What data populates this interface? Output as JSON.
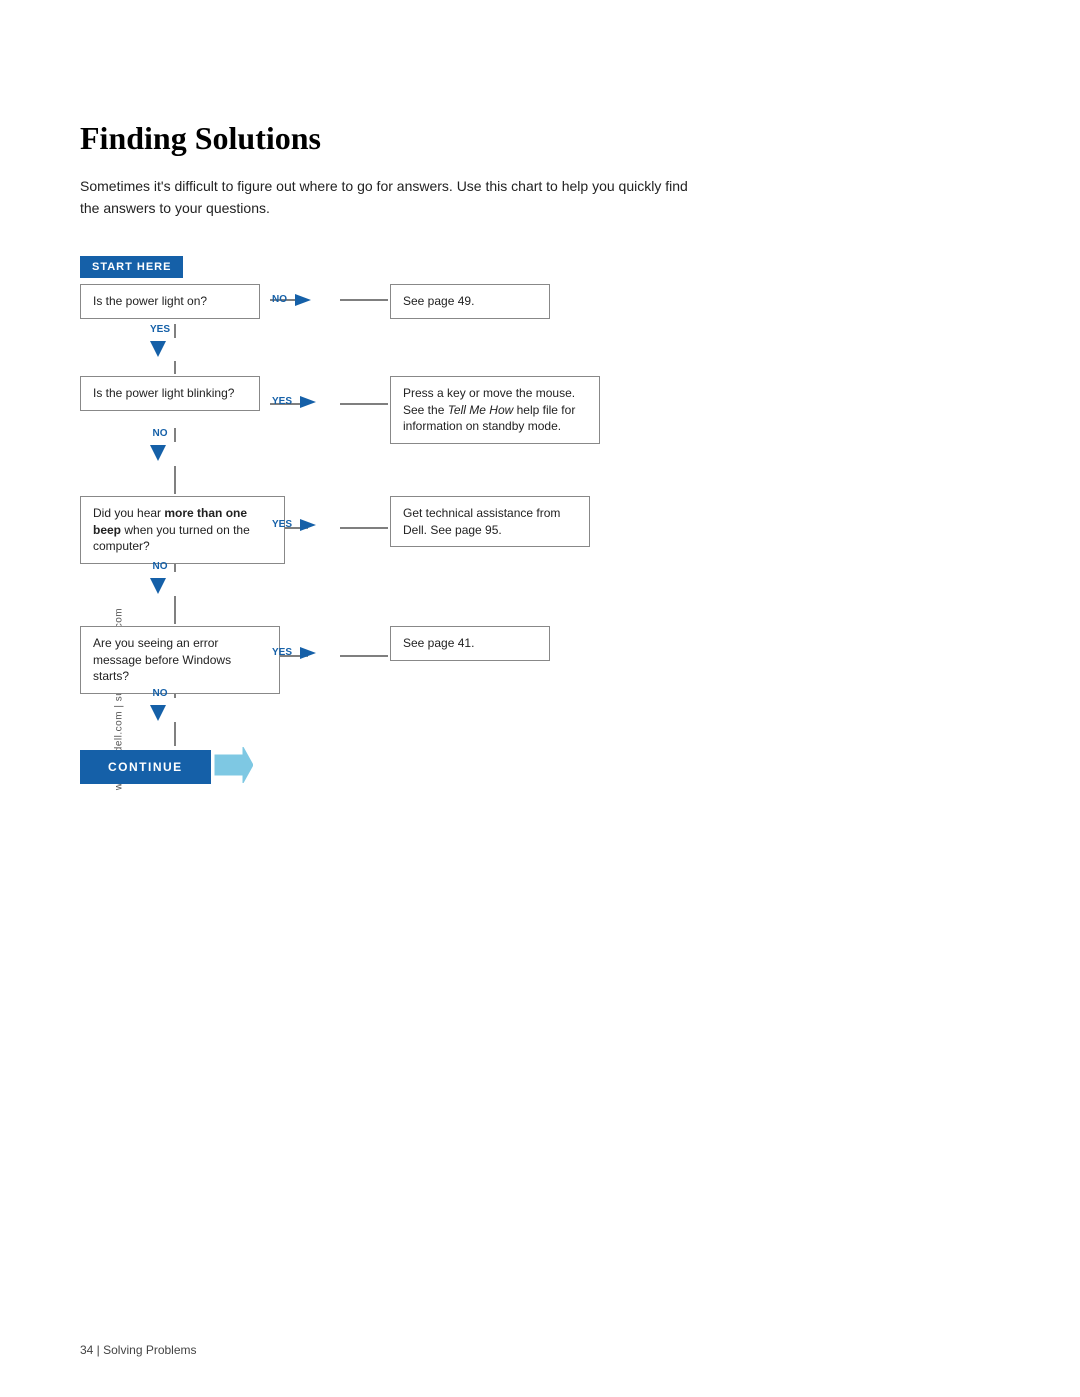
{
  "page": {
    "title": "Finding Solutions",
    "intro": "Sometimes it's difficult to figure out where to go for answers. Use this chart to help you quickly find the answers to your questions.",
    "sidebar_text": "www.jp.dell.com | support.jp.dell.com",
    "footer_text": "34  |  Solving Problems"
  },
  "flowchart": {
    "start_here_label": "START HERE",
    "steps": [
      {
        "id": "q1",
        "question": "Is the power light on?",
        "yes_answer": null,
        "no_answer": "See page 49.",
        "yes_direction": "down",
        "no_direction": "right"
      },
      {
        "id": "q2",
        "question": "Is the power light blinking?",
        "yes_answer": "Press a key or move the mouse. See the Tell Me How help file for information on standby mode.",
        "no_answer": null,
        "yes_direction": "right",
        "no_direction": "down"
      },
      {
        "id": "q3",
        "question": "Did you hear more than one beep when you turned on the computer?",
        "yes_answer": "Get technical assistance from Dell. See page 95.",
        "no_answer": null,
        "yes_direction": "right",
        "no_direction": "down"
      },
      {
        "id": "q4",
        "question": "Are you seeing an error message before Windows starts?",
        "yes_answer": "See page 41.",
        "no_answer": null,
        "yes_direction": "right",
        "no_direction": "down"
      }
    ],
    "continue_label": "CONTINUE",
    "yes_label": "YES",
    "no_label": "NO"
  },
  "colors": {
    "blue": "#1560a8",
    "border": "#888888",
    "text": "#222222",
    "white": "#ffffff"
  }
}
